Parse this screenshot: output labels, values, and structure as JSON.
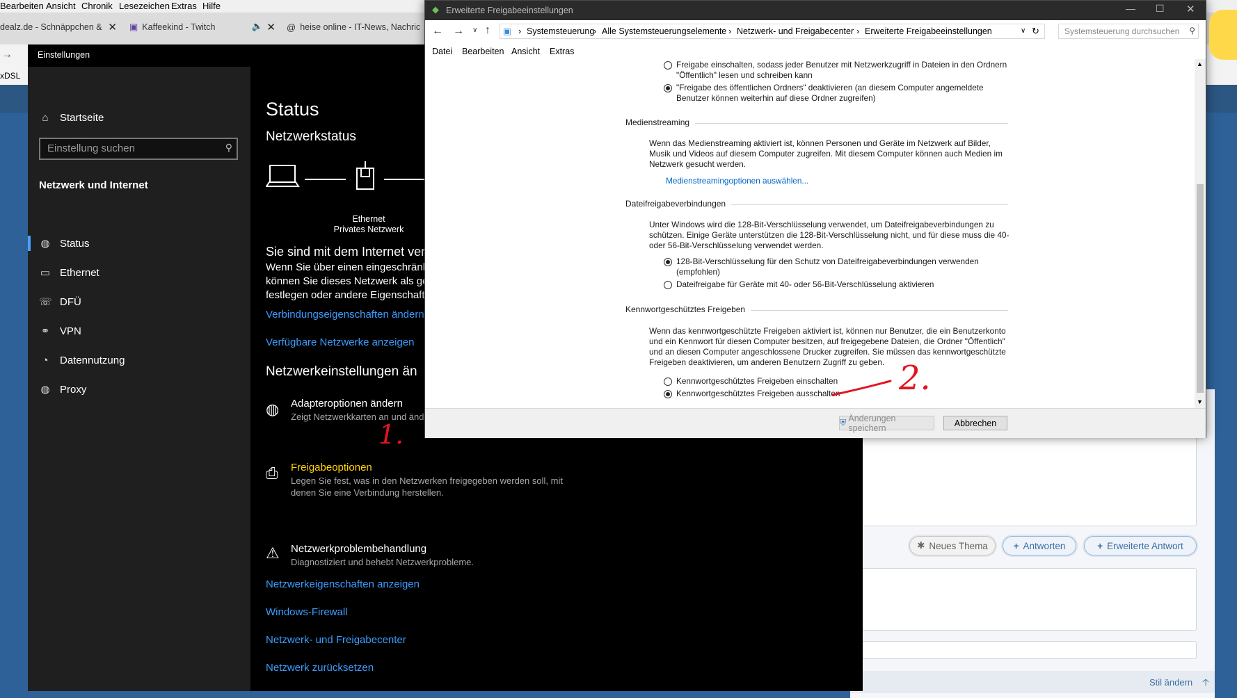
{
  "firefox": {
    "menubar": [
      "Bearbeiten",
      "Ansicht",
      "Chronik",
      "Lesezeichen",
      "Extras",
      "Hilfe"
    ],
    "tabs": [
      {
        "label": "dealz.de - Schnäppchen &"
      },
      {
        "label": "Kaffeekind - Twitch"
      },
      {
        "label": "heise online - IT-News, Nachric"
      }
    ],
    "bookmark_label": "xDSL",
    "forum": {
      "buttons": {
        "new_topic": "Neues Thema",
        "reply": "Antworten",
        "extended_reply": "Erweiterte Antwort"
      },
      "footer_link": "Stil ändern"
    }
  },
  "settings": {
    "title": "Einstellungen",
    "home": "Startseite",
    "search_placeholder": "Einstellung suchen",
    "category": "Netzwerk und Internet",
    "nav": [
      {
        "label": "Status",
        "icon": "globe-icon"
      },
      {
        "label": "Ethernet",
        "icon": "monitor-icon"
      },
      {
        "label": "DFÜ",
        "icon": "dialup-icon"
      },
      {
        "label": "VPN",
        "icon": "vpn-icon"
      },
      {
        "label": "Datennutzung",
        "icon": "pie-icon"
      },
      {
        "label": "Proxy",
        "icon": "globe-icon"
      }
    ],
    "page_title": "Status",
    "network_status_heading": "Netzwerkstatus",
    "diagram": {
      "adapter": "Ethernet",
      "network": "Privates Netzwerk"
    },
    "connected_heading": "Sie sind mit dem Internet ver",
    "connected_text": [
      "Wenn Sie über einen eingeschränk",
      "können Sie dieses Netzwerk als ge",
      "festlegen oder andere Eigenschafte"
    ],
    "link_connection_props": "Verbindungseigenschaften ändern",
    "link_available_networks": "Verfügbare Netzwerke anzeigen",
    "change_settings_heading": "Netzwerkeinstellungen än",
    "options": [
      {
        "title": "Adapteroptionen ändern",
        "desc": [
          "Zeigt Netzwerkkarten an und änd"
        ]
      },
      {
        "title": "Freigabeoptionen",
        "desc": [
          "Legen Sie fest, was in den Netzwerken freigegeben werden soll, mit",
          "denen Sie eine Verbindung herstellen."
        ]
      },
      {
        "title": "Netzwerkproblembehandlung",
        "desc": [
          "Diagnostiziert und behebt Netzwerkprobleme."
        ]
      }
    ],
    "links": [
      "Netzwerkeigenschaften anzeigen",
      "Windows-Firewall",
      "Netzwerk- und Freigabecenter",
      "Netzwerk zurücksetzen"
    ]
  },
  "control_panel": {
    "title": "Erweiterte Freigabeeinstellungen",
    "breadcrumb": [
      "Systemsteuerung",
      "Alle Systemsteuerungselemente",
      "Netzwerk- und Freigabecenter",
      "Erweiterte Freigabeeinstellungen"
    ],
    "search_placeholder": "Systemsteuerung durchsuchen",
    "menu": [
      "Datei",
      "Bearbeiten",
      "Ansicht",
      "Extras"
    ],
    "public_folder": {
      "option_on": [
        "Freigabe einschalten, sodass jeder Benutzer mit Netzwerkzugriff in Dateien in den Ordnern",
        "\"Öffentlich\" lesen und schreiben kann"
      ],
      "option_off": [
        "\"Freigabe des öffentlichen Ordners\" deaktivieren (an diesem Computer angemeldete",
        "Benutzer können weiterhin auf diese Ordner zugreifen)"
      ],
      "selected": "off"
    },
    "media": {
      "heading": "Medienstreaming",
      "text": [
        "Wenn das Medienstreaming aktiviert ist, können Personen und Geräte im Netzwerk auf Bilder,",
        "Musik und Videos auf diesem Computer zugreifen. Mit diesem Computer können auch Medien im",
        "Netzwerk gesucht werden."
      ],
      "link": "Medienstreamingoptionen auswählen..."
    },
    "file_sharing": {
      "heading": "Dateifreigabeverbindungen",
      "text": [
        "Unter Windows wird die 128-Bit-Verschlüsselung verwendet, um Dateifreigabeverbindungen zu",
        "schützen. Einige Geräte unterstützen die 128-Bit-Verschlüsselung nicht, und für diese muss die 40-",
        "oder 56-Bit-Verschlüsselung verwendet werden."
      ],
      "option_128": [
        "128-Bit-Verschlüsselung für den Schutz von Dateifreigabeverbindungen verwenden",
        "(empfohlen)"
      ],
      "option_40_56": "Dateifreigabe für Geräte mit 40- oder 56-Bit-Verschlüsselung aktivieren",
      "selected": "128"
    },
    "password": {
      "heading": "Kennwortgeschütztes Freigeben",
      "text": [
        "Wenn das kennwortgeschützte Freigeben aktiviert ist, können nur Benutzer, die ein Benutzerkonto",
        "und ein Kennwort für diesen Computer besitzen, auf freigegebene Dateien, die Ordner \"Öffentlich\"",
        "und an diesen Computer angeschlossene Drucker zugreifen. Sie müssen das kennwortgeschützte",
        "Freigeben deaktivieren, um anderen Benutzern Zugriff zu geben."
      ],
      "option_on": "Kennwortgeschütztes Freigeben einschalten",
      "option_off": "Kennwortgeschütztes Freigeben ausschalten",
      "selected": "off"
    },
    "buttons": {
      "save": "Änderungen speichern",
      "cancel": "Abbrechen"
    }
  },
  "annotations": {
    "step1": "1.",
    "step2": "2."
  },
  "colors": {
    "accent_link": "#3b9dff",
    "highlight": "#ffd400",
    "annotation": "#e2141f",
    "cp_link": "#0066cc"
  }
}
